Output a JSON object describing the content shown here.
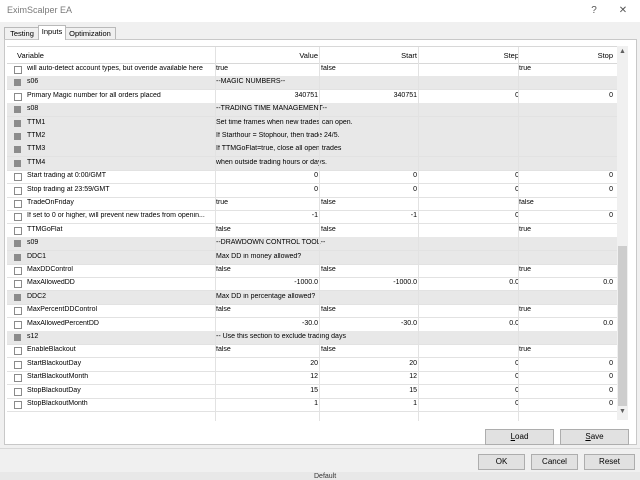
{
  "window": {
    "title": "EximScalper EA",
    "help": "?",
    "close": "✕"
  },
  "tabs": [
    {
      "label": "Testing"
    },
    {
      "label": "Inputs"
    },
    {
      "label": "Optimization"
    }
  ],
  "columns": {
    "variable": "Variable",
    "value": "Value",
    "start": "Start",
    "step": "Step",
    "stop": "Stop"
  },
  "rows": [
    {
      "type": "param",
      "name": "will auto-detect account types, but overide available here",
      "value": "true",
      "start": "false",
      "step": "",
      "stop": "true"
    },
    {
      "type": "section",
      "name": "s06",
      "value": "--MAGIC NUMBERS--"
    },
    {
      "type": "param",
      "name": "Primary Magic number for all orders placed",
      "value": "340751",
      "start": "340751",
      "step": "0",
      "stop": "0",
      "num": true
    },
    {
      "type": "section",
      "name": "s08",
      "value": "--TRADING TIME MANAGEMENT--"
    },
    {
      "type": "section",
      "name": "TTM1",
      "value": "Set time frames when new trades can open."
    },
    {
      "type": "section",
      "name": "TTM2",
      "value": "If Starthour = Stophour, then trade 24/5."
    },
    {
      "type": "section",
      "name": "TTM3",
      "value": "If TTMGoFlat=true, close all open trades"
    },
    {
      "type": "section",
      "name": "TTM4",
      "value": "when outside trading hours or days."
    },
    {
      "type": "param",
      "name": "Start trading at 0:00/GMT",
      "value": "0",
      "start": "0",
      "step": "0",
      "stop": "0",
      "num": true
    },
    {
      "type": "param",
      "name": "Stop trading at 23:59/GMT",
      "value": "0",
      "start": "0",
      "step": "0",
      "stop": "0",
      "num": true
    },
    {
      "type": "param",
      "name": "TradeOnFriday",
      "value": "true",
      "start": "false",
      "step": "",
      "stop": "false"
    },
    {
      "type": "param",
      "name": "If set to 0 or higher, will prevent new trades from openin...",
      "value": "-1",
      "start": "-1",
      "step": "0",
      "stop": "0",
      "num": true
    },
    {
      "type": "param",
      "name": "TTMGoFlat",
      "value": "false",
      "start": "false",
      "step": "",
      "stop": "true"
    },
    {
      "type": "section",
      "name": "s09",
      "value": "--DRAWDOWN CONTROL TOOL--"
    },
    {
      "type": "section",
      "name": "DDC1",
      "value": "Max DD in money allowed?"
    },
    {
      "type": "param",
      "name": "MaxDDControl",
      "value": "false",
      "start": "false",
      "step": "",
      "stop": "true"
    },
    {
      "type": "param",
      "name": "MaxAllowedDD",
      "value": "-1000.0",
      "start": "-1000.0",
      "step": "0.0",
      "stop": "0.0",
      "num": true
    },
    {
      "type": "section",
      "name": "DDC2",
      "value": "Max DD in percentage allowed?"
    },
    {
      "type": "param",
      "name": "MaxPercentDDControl",
      "value": "false",
      "start": "false",
      "step": "",
      "stop": "true"
    },
    {
      "type": "param",
      "name": "MaxAllowedPercentDD",
      "value": "-30.0",
      "start": "-30.0",
      "step": "0.0",
      "stop": "0.0",
      "num": true
    },
    {
      "type": "section",
      "name": "s12",
      "value": "-- Use this section to exclude trading days"
    },
    {
      "type": "param",
      "name": "EnableBlackout",
      "value": "false",
      "start": "false",
      "step": "",
      "stop": "true"
    },
    {
      "type": "param",
      "name": "StartBlackoutDay",
      "value": "20",
      "start": "20",
      "step": "0",
      "stop": "0",
      "num": true
    },
    {
      "type": "param",
      "name": "StartBlackoutMonth",
      "value": "12",
      "start": "12",
      "step": "0",
      "stop": "0",
      "num": true
    },
    {
      "type": "param",
      "name": "StopBlackoutDay",
      "value": "15",
      "start": "15",
      "step": "0",
      "stop": "0",
      "num": true
    },
    {
      "type": "param",
      "name": "StopBlackoutMonth",
      "value": "1",
      "start": "1",
      "step": "0",
      "stop": "0",
      "num": true
    }
  ],
  "buttons": {
    "load": {
      "u": "L",
      "rest": "oad"
    },
    "save": {
      "u": "S",
      "rest": "ave"
    },
    "ok": "OK",
    "cancel": "Cancel",
    "reset": "Reset"
  },
  "background_label": "Default"
}
